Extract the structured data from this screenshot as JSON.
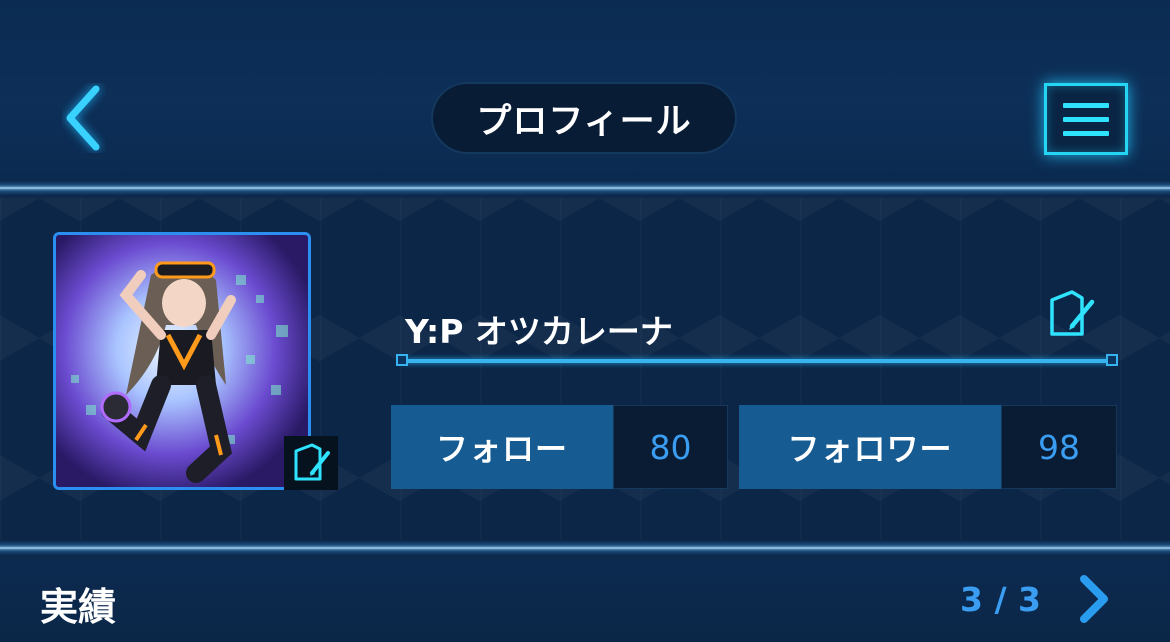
{
  "header": {
    "title": "プロフィール",
    "back_icon": "chevron-left-icon",
    "menu_icon": "hamburger-menu-icon"
  },
  "profile": {
    "name": "Y:P オツカレーナ",
    "avatar_alt": "character-avatar",
    "stats": [
      {
        "label": "フォロー",
        "value": "80"
      },
      {
        "label": "フォロワー",
        "value": "98"
      }
    ]
  },
  "achievements": {
    "title": "実績",
    "page": "3 / 3",
    "next_icon": "chevron-right-icon"
  },
  "colors": {
    "accent": "#2fe3ff",
    "value_blue": "#3a9df2",
    "stat_label_bg": "#165b92"
  }
}
